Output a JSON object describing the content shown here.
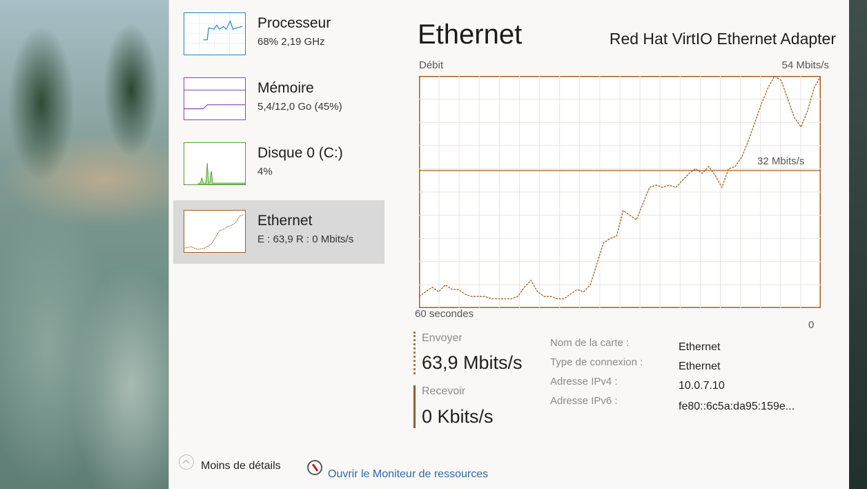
{
  "sidebar": {
    "items": [
      {
        "title": "Processeur",
        "subtitle": "68% 2,19 GHz",
        "color": "#1b86c9"
      },
      {
        "title": "Mémoire",
        "subtitle": "5,4/12,0 Go (45%)",
        "color": "#8e3fb5"
      },
      {
        "title": "Disque 0 (C:)",
        "subtitle": "4%",
        "color": "#4da02c"
      },
      {
        "title": "Ethernet",
        "subtitle": "E : 63,9 R : 0 Mbits/s",
        "color": "#a65e1f",
        "selected": true
      }
    ]
  },
  "main": {
    "title": "Ethernet",
    "adapter": "Red Hat VirtIO Ethernet Adapter",
    "graph": {
      "label": "Débit",
      "max_label": "54 Mbits/s",
      "mid_label": "32 Mbits/s",
      "time_label": "60 secondes",
      "zero_label": "0"
    },
    "send": {
      "label": "Envoyer",
      "value": "63,9 Mbits/s"
    },
    "receive": {
      "label": "Recevoir",
      "value": "0 Kbits/s"
    },
    "properties": [
      {
        "key": "Nom de la carte :",
        "value": "Ethernet"
      },
      {
        "key": "Type de connexion :",
        "value": "Ethernet"
      },
      {
        "key": "Adresse IPv4 :",
        "value": "10.0.7.10"
      },
      {
        "key": "Adresse IPv6 :",
        "value": "fe80::6c5a:da95:159e..."
      }
    ]
  },
  "footer": {
    "less_details": "Moins de détails",
    "open_monitor": "Ouvrir le Moniteur de ressources"
  },
  "colors": {
    "accent": "#a65e1f",
    "link": "#2f6aa6"
  },
  "chart_data": {
    "type": "line",
    "ylim": [
      0,
      54
    ],
    "reference_line": 32,
    "series": [
      {
        "values": [
          5,
          7,
          9,
          7,
          10,
          8,
          8,
          6,
          5,
          5,
          5,
          4,
          4,
          4,
          4,
          5,
          9,
          12,
          7,
          5,
          5,
          4,
          4,
          6,
          8,
          7,
          10,
          19,
          28,
          30,
          31,
          42,
          40,
          38,
          45,
          52,
          53,
          52,
          53,
          52,
          55,
          58,
          60,
          58,
          61,
          57,
          52,
          60,
          61,
          65,
          72,
          80,
          88,
          95,
          100,
          98,
          90,
          82,
          78,
          85,
          95,
          100
        ]
      }
    ]
  }
}
